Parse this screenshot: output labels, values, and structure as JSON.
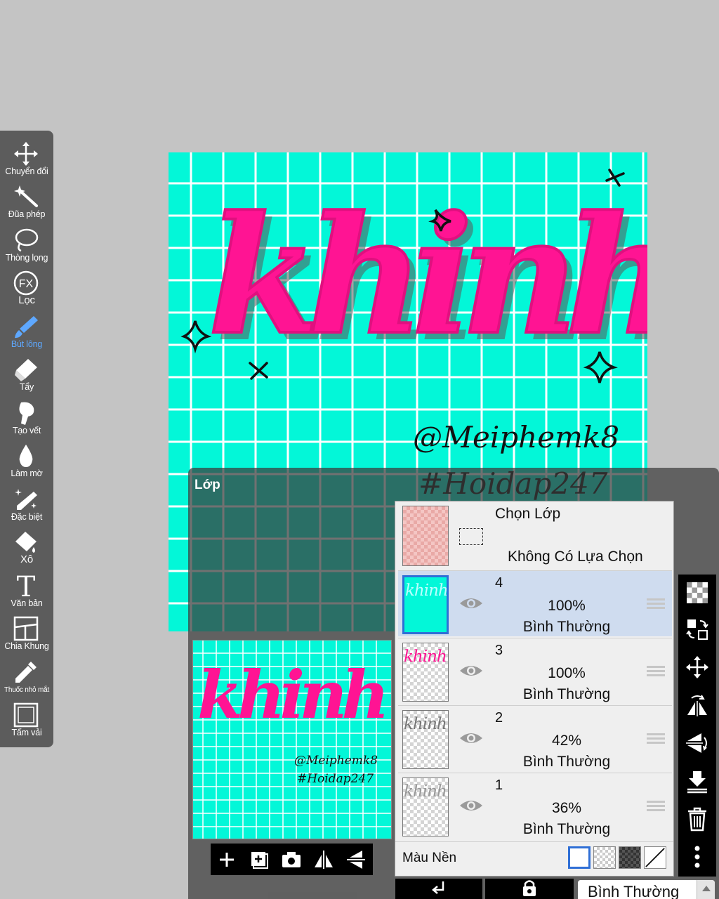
{
  "toolbar": {
    "items": [
      {
        "label": "Chuyển đổi",
        "icon": "move-arrows-icon"
      },
      {
        "label": "Đũa phép",
        "icon": "magic-wand-icon"
      },
      {
        "label": "Thòng lọng",
        "icon": "lasso-icon"
      },
      {
        "label": "Lọc",
        "icon": "fx-filter-icon"
      },
      {
        "label": "Bút lông",
        "icon": "brush-icon"
      },
      {
        "label": "Tẩy",
        "icon": "eraser-icon"
      },
      {
        "label": "Tạo vết",
        "icon": "smudge-icon"
      },
      {
        "label": "Làm mờ",
        "icon": "blur-drop-icon"
      },
      {
        "label": "Đặc biệt",
        "icon": "special-brush-icon"
      },
      {
        "label": "Xô",
        "icon": "bucket-icon"
      },
      {
        "label": "Văn bản",
        "icon": "text-icon"
      },
      {
        "label": "Chia Khung",
        "icon": "frame-divider-icon"
      },
      {
        "label": "Thuốc nhỏ mắt",
        "icon": "eyedropper-icon"
      },
      {
        "label": "Tấm vải",
        "icon": "canvas-icon"
      }
    ],
    "fx_text": "FX",
    "text_tool_glyph": "T"
  },
  "artwork": {
    "title_text": "khinh",
    "credit_line1": "@Meiphemk8",
    "credit_line2": "#Hoidap247"
  },
  "layer_panel": {
    "title": "Lớp",
    "selection": {
      "title": "Chọn Lớp",
      "subtitle": "Không Có Lựa Chọn"
    },
    "layers": [
      {
        "number": "4",
        "opacity": "100%",
        "mode": "Bình Thường",
        "thumb_text": "khinh"
      },
      {
        "number": "3",
        "opacity": "100%",
        "mode": "Bình Thường",
        "thumb_text": "khinh"
      },
      {
        "number": "2",
        "opacity": "42%",
        "mode": "Bình Thường",
        "thumb_text": "khinh"
      },
      {
        "number": "1",
        "opacity": "36%",
        "mode": "Bình Thường",
        "thumb_text": "khinh"
      }
    ],
    "background": {
      "label": "Màu Nền"
    },
    "blend_mode_value": "Bình Thường"
  },
  "colors": {
    "canvas_bg": "#03f7d8",
    "grid_line": "#ffffff",
    "lettering": "#ff1493",
    "highlight_blue": "#2f6fd6",
    "active_tool": "#5ea8ff"
  }
}
